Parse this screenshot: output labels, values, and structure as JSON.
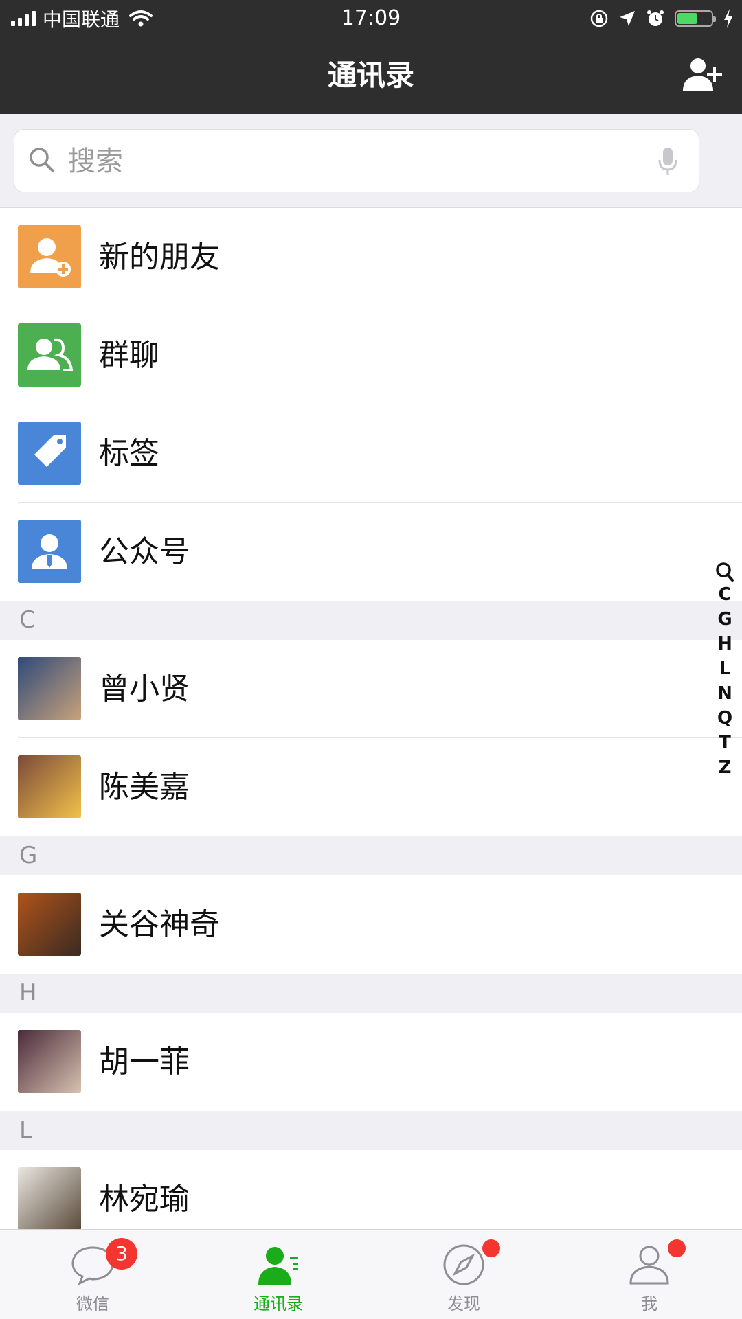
{
  "status_bar": {
    "carrier": "中国联通",
    "time": "17:09",
    "battery_level": 0.6,
    "battery_color": "#4cd964"
  },
  "nav": {
    "title": "通讯录",
    "add_friend_icon": "add-user-icon"
  },
  "search": {
    "placeholder": "搜索",
    "value": "",
    "icons": [
      "search-icon",
      "microphone-icon"
    ]
  },
  "functions": [
    {
      "label": "新的朋友",
      "icon": "new-friend-icon",
      "color": "#f0a04b"
    },
    {
      "label": "群聊",
      "icon": "group-chat-icon",
      "color": "#4caf50"
    },
    {
      "label": "标签",
      "icon": "tag-icon",
      "color": "#4a86d8"
    },
    {
      "label": "公众号",
      "icon": "official-account-icon",
      "color": "#4a86d8"
    }
  ],
  "sections": [
    {
      "letter": "C",
      "contacts": [
        "曾小贤",
        "陈美嘉"
      ]
    },
    {
      "letter": "G",
      "contacts": [
        "关谷神奇"
      ]
    },
    {
      "letter": "H",
      "contacts": [
        "胡一菲"
      ]
    },
    {
      "letter": "L",
      "contacts": [
        "林宛瑜"
      ]
    }
  ],
  "index_bar": [
    "C",
    "G",
    "H",
    "L",
    "N",
    "Q",
    "T",
    "Z"
  ],
  "tab_bar": {
    "accent_color": "#1aad19",
    "badge_color": "#f43530",
    "tabs": [
      {
        "label": "微信",
        "icon": "chat-bubble-icon",
        "badge": "3",
        "active": false
      },
      {
        "label": "通讯录",
        "icon": "contacts-icon",
        "badge": null,
        "active": true
      },
      {
        "label": "发现",
        "icon": "compass-icon",
        "badge_dot": true,
        "active": false
      },
      {
        "label": "我",
        "icon": "profile-icon",
        "badge_dot": true,
        "active": false
      }
    ]
  }
}
